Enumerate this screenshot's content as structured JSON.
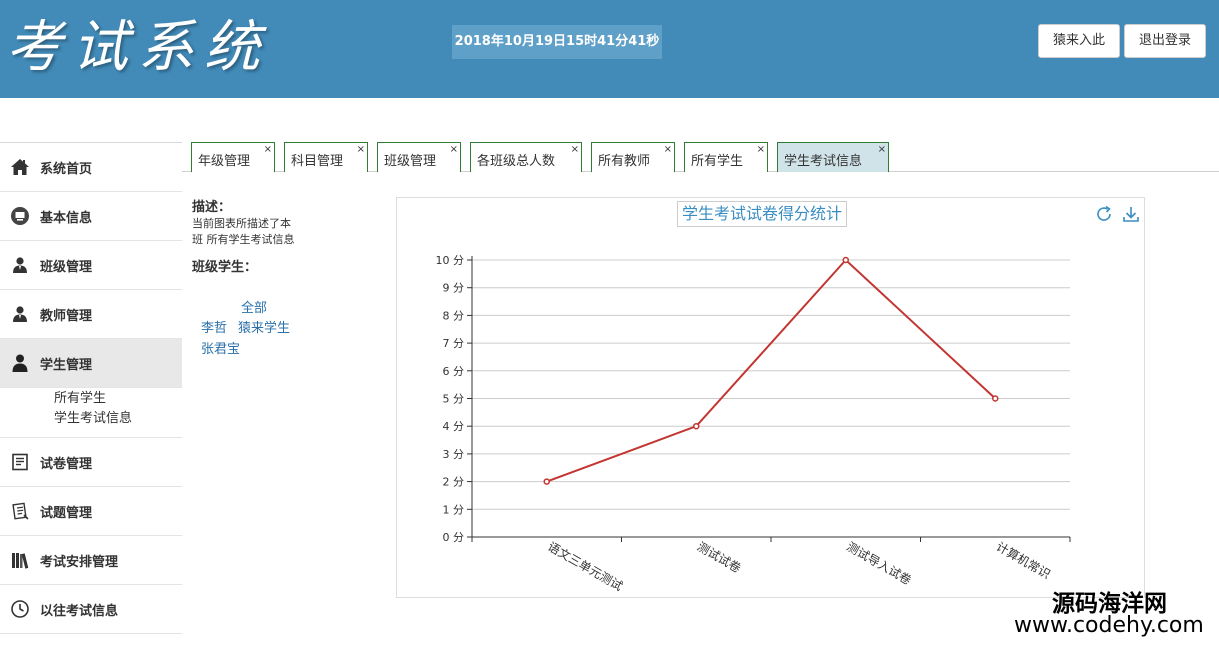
{
  "header": {
    "logo": "考试系统",
    "datetime": "2018年10月19日15时41分41秒",
    "user_button": "猿来入此",
    "logout_button": "退出登录"
  },
  "sidebar": {
    "items": [
      {
        "label": "系统首页",
        "icon": "home-icon"
      },
      {
        "label": "基本信息",
        "icon": "monitor-icon"
      },
      {
        "label": "班级管理",
        "icon": "user-icon"
      },
      {
        "label": "教师管理",
        "icon": "user-icon"
      },
      {
        "label": "学生管理",
        "icon": "user-icon"
      },
      {
        "label": "试卷管理",
        "icon": "paper-icon"
      },
      {
        "label": "试题管理",
        "icon": "question-icon"
      },
      {
        "label": "考试安排管理",
        "icon": "books-icon"
      },
      {
        "label": "以往考试信息",
        "icon": "clock-icon"
      }
    ],
    "sub_items": [
      "所有学生",
      "学生考试信息"
    ]
  },
  "tabs": [
    {
      "label": "年级管理"
    },
    {
      "label": "科目管理"
    },
    {
      "label": "班级管理"
    },
    {
      "label": "各班级总人数"
    },
    {
      "label": "所有教师"
    },
    {
      "label": "所有学生"
    },
    {
      "label": "学生考试信息"
    }
  ],
  "tab_close": "×",
  "info": {
    "desc_title": "描述：",
    "desc_text": "当前图表所描述了本班 所有学生考试信息",
    "students_title": "班级学生：",
    "students": [
      "全部",
      "李哲",
      "猿来学生",
      "张君宝"
    ]
  },
  "chart_data": {
    "type": "line",
    "title": "学生考试试卷得分统计",
    "categories": [
      "语文三单元测试",
      "测试试卷",
      "测试导入试卷",
      "计算机常识"
    ],
    "values": [
      2,
      4,
      10,
      5
    ],
    "ylim": [
      0,
      10
    ],
    "y_ticks": [
      0,
      1,
      2,
      3,
      4,
      5,
      6,
      7,
      8,
      9,
      10
    ],
    "y_unit": "分",
    "grid": true,
    "line_color": "#c23531"
  },
  "colors": {
    "header_bg": "#428bb9",
    "tab_border": "#2e7d32",
    "active_tab_bg": "#cfe3e9",
    "link": "#2a6fa8"
  },
  "watermark": {
    "line1": "源码海洋网",
    "line2": "www.codehy.com"
  }
}
